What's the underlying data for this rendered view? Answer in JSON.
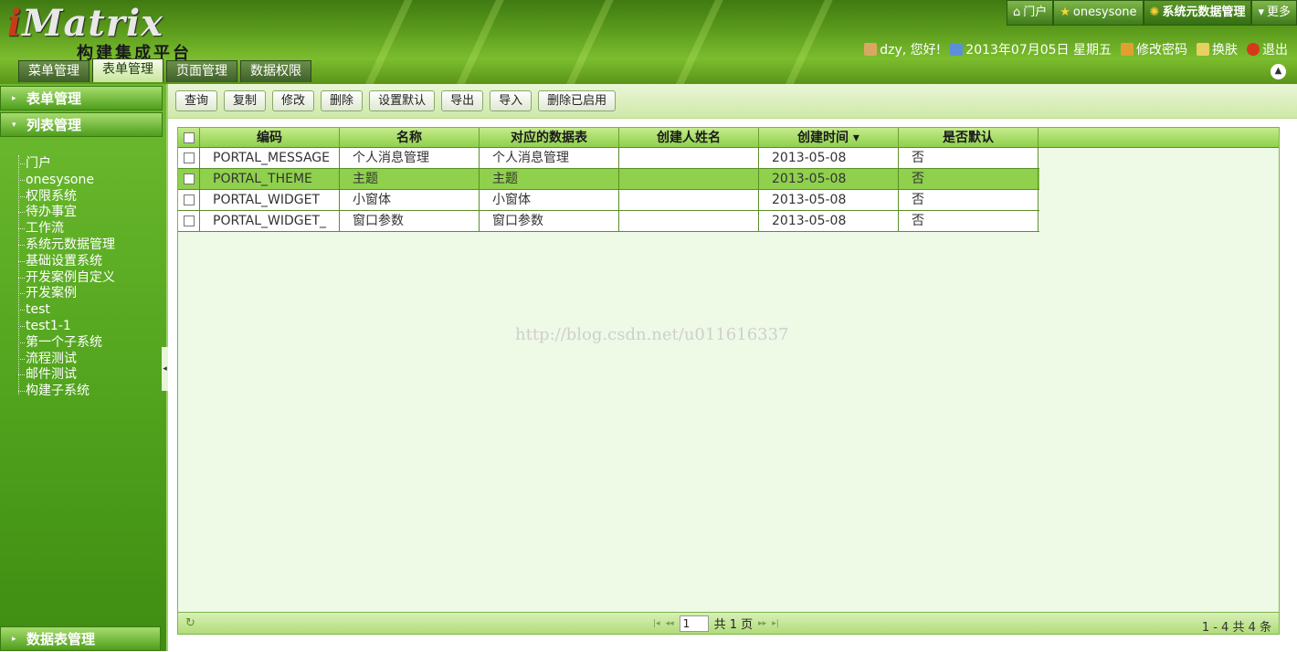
{
  "header": {
    "logo_i": "i",
    "logo_rest": "Matrix",
    "subtitle": "构建集成平台",
    "tabs": [
      "菜单管理",
      "表单管理",
      "页面管理",
      "数据权限"
    ],
    "shortcuts": {
      "portal": "门户",
      "onesysone": "onesysone",
      "meta": "系统元数据管理",
      "more": "更多"
    },
    "user": {
      "greeting": "dzy, 您好!",
      "date": "2013年07月05日 星期五",
      "change_pwd": "修改密码",
      "skin": "换肤",
      "logout": "退出"
    }
  },
  "sidebar": {
    "section1": "表单管理",
    "section2": "列表管理",
    "section3": "数据表管理",
    "tree": [
      "门户",
      "onesysone",
      "权限系统",
      "待办事宜",
      "工作流",
      "系统元数据管理",
      "基础设置系统",
      "开发案例自定义",
      "开发案例",
      "test",
      "test1-1",
      "第一个子系统",
      "流程测试",
      "邮件测试",
      "构建子系统"
    ]
  },
  "toolbar": [
    "查询",
    "复制",
    "修改",
    "删除",
    "设置默认",
    "导出",
    "导入",
    "删除已启用"
  ],
  "grid": {
    "headers": [
      "编码",
      "名称",
      "对应的数据表",
      "创建人姓名",
      "创建时间 ▾",
      "是否默认"
    ],
    "rows": [
      [
        "PORTAL_MESSAGE",
        "个人消息管理",
        "个人消息管理",
        "",
        "2013-05-08",
        "否"
      ],
      [
        "PORTAL_THEME",
        "主题",
        "主题",
        "",
        "2013-05-08",
        "否"
      ],
      [
        "PORTAL_WIDGET",
        "小窗体",
        "小窗体",
        "",
        "2013-05-08",
        "否"
      ],
      [
        "PORTAL_WIDGET_",
        "窗口参数",
        "窗口参数",
        "",
        "2013-05-08",
        "否"
      ]
    ]
  },
  "pager": {
    "page": "1",
    "total_pages": "共 1 页",
    "summary": "1 - 4  共 4 条"
  },
  "watermark": "http://blog.csdn.net/u011616337",
  "colors": {
    "accent": "#8fd04c",
    "sidebar": "#4fa11c"
  }
}
